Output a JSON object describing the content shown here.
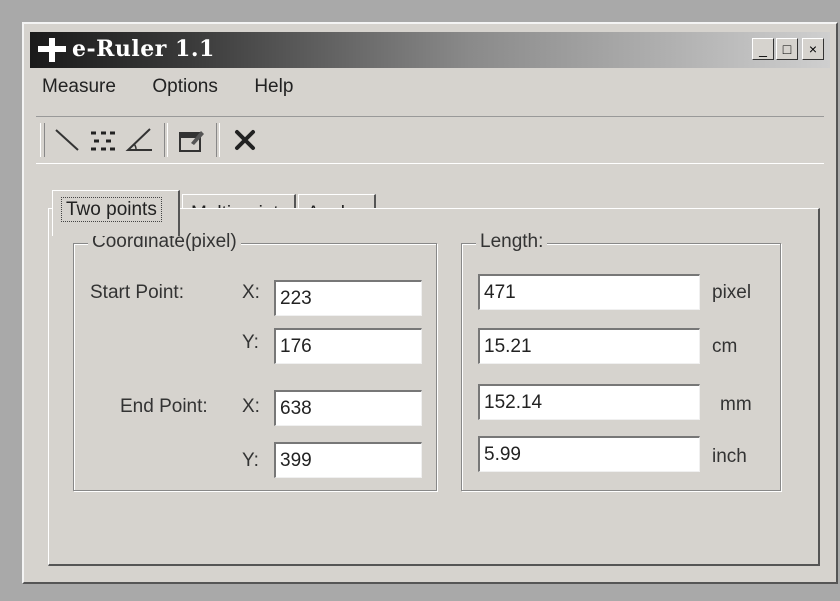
{
  "window": {
    "title": "e-Ruler 1.1",
    "controls": {
      "minimize": "_",
      "maximize": "□",
      "close": "×"
    }
  },
  "menu": {
    "items": [
      "Measure",
      "Options",
      "Help"
    ]
  },
  "toolbar": {
    "icons": [
      "line-tool-icon",
      "multipoint-tool-icon",
      "angle-tool-icon",
      "settings-window-icon",
      "clear-icon"
    ]
  },
  "tabs": [
    "Two points",
    "Multi-point",
    "Angle"
  ],
  "coordinate": {
    "group_label": "Coordinate(pixel)",
    "start_label": "Start Point:",
    "end_label": "End Point:",
    "x_label": "X:",
    "y_label": "Y:",
    "start_x": "223",
    "start_y": "176",
    "end_x": "638",
    "end_y": "399"
  },
  "length": {
    "group_label": "Length:",
    "rows": [
      {
        "value": "471",
        "unit": "pixel"
      },
      {
        "value": "15.21",
        "unit": "cm"
      },
      {
        "value": "152.14",
        "unit": "mm"
      },
      {
        "value": "5.99",
        "unit": "inch"
      }
    ]
  },
  "colors": {
    "face": "#d6d3ce",
    "titlebar_dark": "#1a1a1a",
    "backdrop": "#a9a9a9"
  }
}
